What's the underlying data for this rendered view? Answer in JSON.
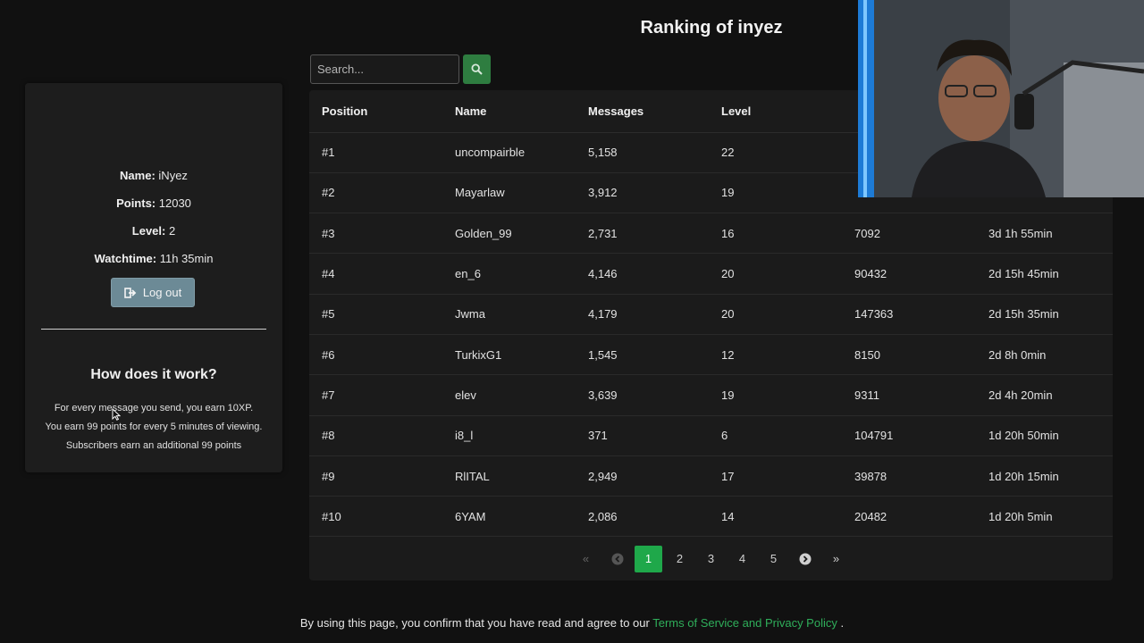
{
  "page": {
    "title": "Ranking of inyez"
  },
  "profile": {
    "name_label": "Name:",
    "name": "iNyez",
    "points_label": "Points:",
    "points": "12030",
    "level_label": "Level:",
    "level": "2",
    "watchtime_label": "Watchtime:",
    "watchtime": "11h 35min",
    "logout_label": "Log out"
  },
  "how": {
    "title": "How does it work?",
    "lines": [
      "For every message you send, you earn 10XP.",
      "You earn 99 points for every 5 minutes of viewing.",
      "Subscribers earn an additional 99 points"
    ]
  },
  "search": {
    "placeholder": "Search..."
  },
  "table": {
    "headers": [
      "Position",
      "Name",
      "Messages",
      "Level",
      "",
      ""
    ],
    "rows": [
      [
        "#1",
        "uncompairble",
        "5,158",
        "22",
        "",
        ""
      ],
      [
        "#2",
        "Mayarlaw",
        "3,912",
        "19",
        "",
        ""
      ],
      [
        "#3",
        "Golden_99",
        "2,731",
        "16",
        "7092",
        "3d 1h 55min"
      ],
      [
        "#4",
        "en_6",
        "4,146",
        "20",
        "90432",
        "2d 15h 45min"
      ],
      [
        "#5",
        "Jwma",
        "4,179",
        "20",
        "147363",
        "2d 15h 35min"
      ],
      [
        "#6",
        "TurkixG1",
        "1,545",
        "12",
        "8150",
        "2d 8h 0min"
      ],
      [
        "#7",
        "elev",
        "3,639",
        "19",
        "9311",
        "2d 4h 20min"
      ],
      [
        "#8",
        "i8_l",
        "371",
        "6",
        "104791",
        "1d 20h 50min"
      ],
      [
        "#9",
        "RlITAL",
        "2,949",
        "17",
        "39878",
        "1d 20h 15min"
      ],
      [
        "#10",
        "6YAM",
        "2,086",
        "14",
        "20482",
        "1d 20h 5min"
      ]
    ]
  },
  "pagination": {
    "first": "«",
    "prev": "‹",
    "pages": [
      "1",
      "2",
      "3",
      "4",
      "5"
    ],
    "active_page": "1",
    "next": "›",
    "last": "»"
  },
  "footer": {
    "prefix": "By using this page, you confirm that you have read and agree to our",
    "link": "Terms of Service and Privacy Policy",
    "suffix": "."
  },
  "colors": {
    "accent": "#1fa84a",
    "link": "#2fae5a",
    "logout": "#6c8a96",
    "search_button": "#2e7d40"
  }
}
